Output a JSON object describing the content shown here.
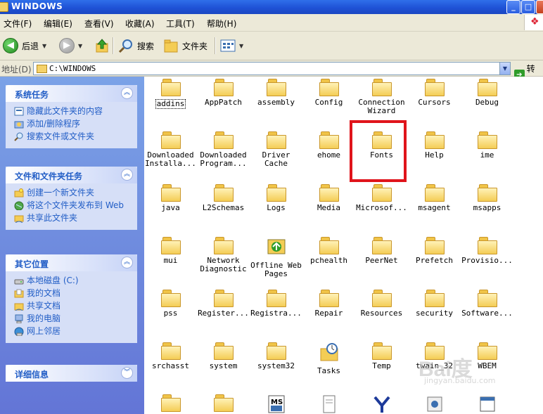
{
  "window": {
    "title": "WINDOWS"
  },
  "menu": [
    "文件(F)",
    "编辑(E)",
    "查看(V)",
    "收藏(A)",
    "工具(T)",
    "帮助(H)"
  ],
  "toolbar": {
    "back_label": "后退",
    "search_label": "搜索",
    "folders_label": "文件夹"
  },
  "address": {
    "label": "地址(D)",
    "value": "C:\\WINDOWS",
    "go_label": "转到"
  },
  "left": {
    "system_tasks": {
      "title": "系统任务",
      "items": [
        "隐藏此文件夹的内容",
        "添加/删除程序",
        "搜索文件或文件夹"
      ]
    },
    "file_tasks": {
      "title": "文件和文件夹任务",
      "items": [
        "创建一个新文件夹",
        "将这个文件夹发布到 Web",
        "共享此文件夹"
      ]
    },
    "other_places": {
      "title": "其它位置",
      "items": [
        "本地磁盘 (C:)",
        "我的文档",
        "共享文档",
        "我的电脑",
        "网上邻居"
      ]
    },
    "details": {
      "title": "详细信息"
    }
  },
  "files": [
    {
      "name": "addins",
      "icon": "folder-icon"
    },
    {
      "name": "AppPatch",
      "icon": "folder-icon"
    },
    {
      "name": "assembly",
      "icon": "folder-icon"
    },
    {
      "name": "Config",
      "icon": "folder-icon"
    },
    {
      "name": "Connection Wizard",
      "icon": "folder-icon"
    },
    {
      "name": "Cursors",
      "icon": "folder-icon"
    },
    {
      "name": "Debug",
      "icon": "folder-icon"
    },
    {
      "name": "Downloaded Installa...",
      "icon": "folder-icon"
    },
    {
      "name": "Downloaded Program...",
      "icon": "folder-icon"
    },
    {
      "name": "Driver Cache",
      "icon": "folder-icon"
    },
    {
      "name": "ehome",
      "icon": "folder-icon"
    },
    {
      "name": "Fonts",
      "icon": "folder-icon"
    },
    {
      "name": "Help",
      "icon": "folder-icon"
    },
    {
      "name": "ime",
      "icon": "folder-icon"
    },
    {
      "name": "java",
      "icon": "folder-icon"
    },
    {
      "name": "L2Schemas",
      "icon": "folder-icon"
    },
    {
      "name": "Logs",
      "icon": "folder-icon"
    },
    {
      "name": "Media",
      "icon": "folder-icon"
    },
    {
      "name": "Microsof...",
      "icon": "folder-icon"
    },
    {
      "name": "msagent",
      "icon": "folder-icon"
    },
    {
      "name": "msapps",
      "icon": "folder-icon"
    },
    {
      "name": "mui",
      "icon": "folder-icon"
    },
    {
      "name": "Network Diagnostic",
      "icon": "folder-icon"
    },
    {
      "name": "Offline Web Pages",
      "icon": "offline-web-pages-icon"
    },
    {
      "name": "pchealth",
      "icon": "folder-icon"
    },
    {
      "name": "PeerNet",
      "icon": "folder-icon"
    },
    {
      "name": "Prefetch",
      "icon": "folder-icon"
    },
    {
      "name": "Provisio...",
      "icon": "folder-icon"
    },
    {
      "name": "pss",
      "icon": "folder-icon"
    },
    {
      "name": "Register...",
      "icon": "folder-icon"
    },
    {
      "name": "Registra...",
      "icon": "folder-icon"
    },
    {
      "name": "Repair",
      "icon": "folder-icon"
    },
    {
      "name": "Resources",
      "icon": "folder-icon"
    },
    {
      "name": "security",
      "icon": "folder-icon"
    },
    {
      "name": "Software...",
      "icon": "folder-icon"
    },
    {
      "name": "srchasst",
      "icon": "folder-icon"
    },
    {
      "name": "system",
      "icon": "folder-icon"
    },
    {
      "name": "system32",
      "icon": "folder-icon"
    },
    {
      "name": "Tasks",
      "icon": "tasks-folder-icon"
    },
    {
      "name": "Temp",
      "icon": "folder-icon"
    },
    {
      "name": "twain_32",
      "icon": "folder-icon"
    },
    {
      "name": "WBEM",
      "icon": "folder-icon"
    }
  ],
  "bottom_row_icons": [
    "folder-icon",
    "folder-icon",
    "ms-dos-icon",
    "document-icon",
    "app-icon",
    "setup-icon",
    "window-icon"
  ],
  "watermark": {
    "text": "Bai度",
    "sub": "jingyan.baidu.com"
  },
  "colors": {
    "titlebar": "#245edb",
    "taskpane": "#7ba2e7",
    "link": "#215dc6",
    "highlight": "#e0141b"
  }
}
